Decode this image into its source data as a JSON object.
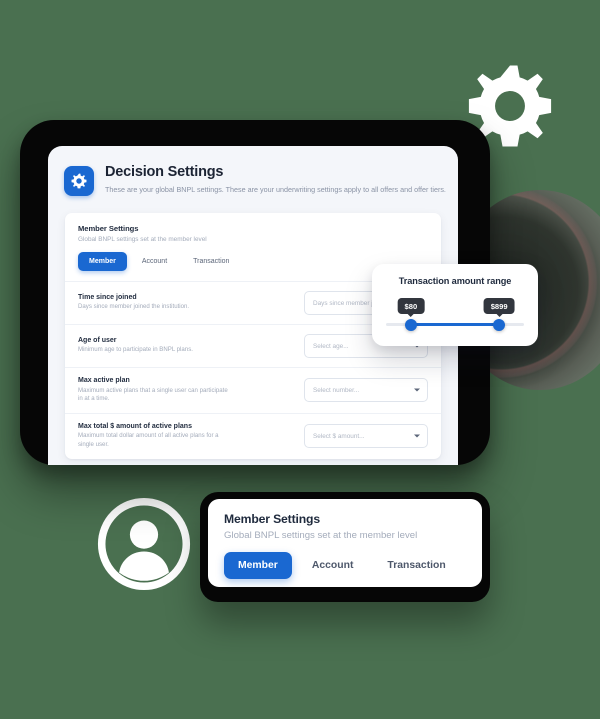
{
  "theme": {
    "background": "#4a7050",
    "accent": "#1a68d1",
    "frame": "#060606",
    "screen_bg": "#f4f6fa",
    "bubble_bg": "#32363e"
  },
  "decor": {
    "gear_icon": "gear-icon",
    "avatar_icon": "user-avatar-icon",
    "disc": "dark-disc-decoration"
  },
  "app": {
    "badge_icon": "gear-icon",
    "title": "Decision Settings",
    "subtitle": "These are your global BNPL settings. These are your underwriting settings apply to all offers and offer tiers."
  },
  "member_card": {
    "title": "Member Settings",
    "subtitle": "Global BNPL settings set at the member level",
    "tabs": [
      {
        "label": "Member",
        "active": true
      },
      {
        "label": "Account",
        "active": false
      },
      {
        "label": "Transaction",
        "active": false
      }
    ],
    "rows": [
      {
        "title": "Time since joined",
        "desc": "Days since member joined the institution.",
        "control": "input",
        "placeholder": "Days since member joined here.",
        "value": ""
      },
      {
        "title": "Age of user",
        "desc": "Minimum age to participate in BNPL plans.",
        "control": "select",
        "placeholder": "Select age...",
        "value": ""
      },
      {
        "title": "Max active plan",
        "desc": "Maximum active plans that a single user can participate in at a time.",
        "control": "select",
        "placeholder": "Select number...",
        "value": ""
      },
      {
        "title": "Max total $ amount of active plans",
        "desc": "Maximum total dollar amount of all active plans for a single user.",
        "control": "select",
        "placeholder": "Select $ amount...",
        "value": ""
      }
    ]
  },
  "slider_popup": {
    "title": "Transaction amount range",
    "min_label": "$80",
    "max_label": "$899",
    "min_percent": 18,
    "max_percent": 82
  },
  "zoom_card": {
    "title": "Member Settings",
    "subtitle": "Global BNPL settings set at the member level",
    "tabs": [
      {
        "label": "Member",
        "active": true
      },
      {
        "label": "Account",
        "active": false
      },
      {
        "label": "Transaction",
        "active": false
      }
    ]
  }
}
